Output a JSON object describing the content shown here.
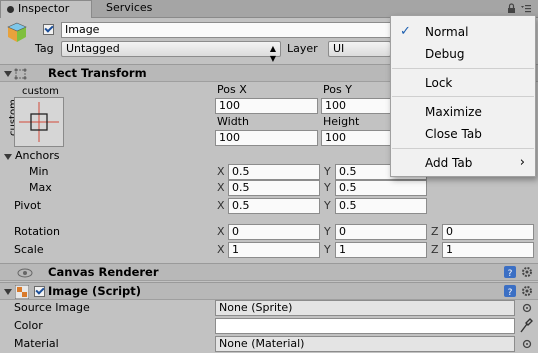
{
  "tabs": [
    {
      "label": "Inspector",
      "active": true
    },
    {
      "label": "Services",
      "active": false
    }
  ],
  "object": {
    "name": "Image",
    "tag_label": "Tag",
    "tag_value": "Untagged",
    "layer_label": "Layer",
    "layer_value": "UI"
  },
  "rect_transform": {
    "title": "Rect Transform",
    "anchor_preset_top": "custom",
    "anchor_preset_side": "custom",
    "pos_x_label": "Pos X",
    "pos_y_label": "Pos Y",
    "pos_x": "100",
    "pos_y": "100",
    "width_label": "Width",
    "height_label": "Height",
    "width": "100",
    "height": "100",
    "anchors_label": "Anchors",
    "min_label": "Min",
    "max_label": "Max",
    "anchor_min_x": "0.5",
    "anchor_min_y": "0.5",
    "anchor_max_x": "0.5",
    "anchor_max_y": "0.5",
    "pivot_label": "Pivot",
    "pivot_x": "0.5",
    "pivot_y": "0.5",
    "rotation_label": "Rotation",
    "rot_x": "0",
    "rot_y": "0",
    "rot_z": "0",
    "scale_label": "Scale",
    "scale_x": "1",
    "scale_y": "1",
    "scale_z": "1",
    "x_axis": "X",
    "y_axis": "Y",
    "z_axis": "Z"
  },
  "canvas_renderer": {
    "title": "Canvas Renderer"
  },
  "image_script": {
    "title": "Image (Script)",
    "source_image_label": "Source Image",
    "source_image_value": "None (Sprite)",
    "color_label": "Color",
    "color_value": "#ffffff",
    "material_label": "Material",
    "material_value": "None (Material)"
  },
  "context_menu": {
    "items": [
      {
        "label": "Normal",
        "checked": true
      },
      {
        "label": "Debug",
        "checked": false
      },
      {
        "label": "Lock",
        "checked": false
      },
      {
        "label": "Maximize",
        "checked": false
      },
      {
        "label": "Close Tab",
        "checked": false
      },
      {
        "label": "Add Tab",
        "submenu": true
      }
    ],
    "submenu_arrow": "›",
    "check_mark": "✓"
  },
  "colors": {
    "accent_check": "#1c5fb0",
    "help_icon": "#3b6fc4",
    "panel_bg": "#c2c2c2"
  }
}
